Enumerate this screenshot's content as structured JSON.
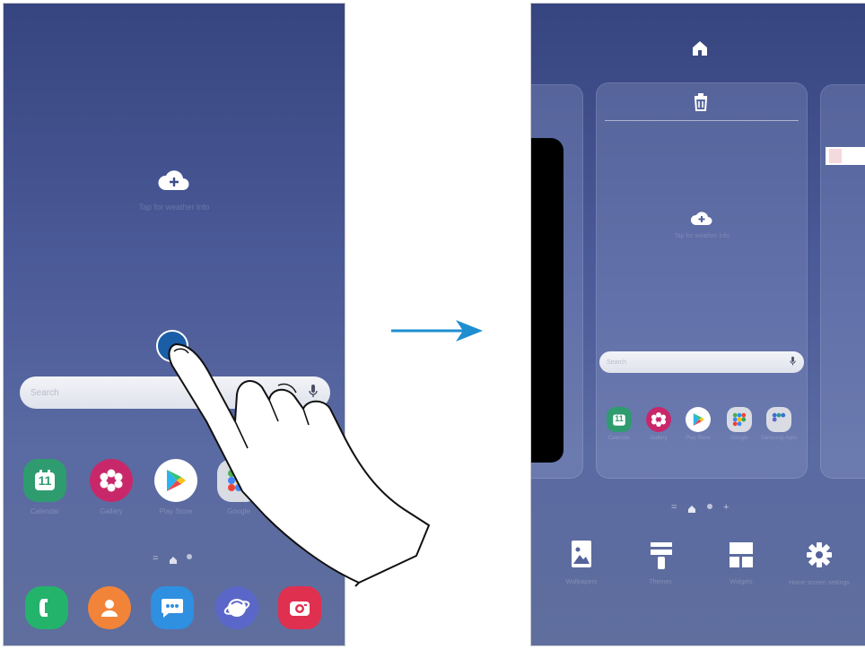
{
  "left_screen": {
    "weather_hint": "Tap for weather info",
    "search_placeholder": "Search",
    "apps": [
      {
        "name": "Calendar",
        "icon": "calendar-icon",
        "color": "#2f9c6f",
        "day": "11"
      },
      {
        "name": "Gallery",
        "icon": "flower-icon",
        "color": "#c8286a"
      },
      {
        "name": "Play Store",
        "icon": "play-store-icon",
        "color": "#ffffff"
      },
      {
        "name": "Google",
        "icon": "folder-icon",
        "color": "#dadce4"
      }
    ],
    "dock": [
      {
        "name": "Phone",
        "icon": "phone-icon",
        "color": "#23b36b"
      },
      {
        "name": "Contacts",
        "icon": "contacts-icon",
        "color": "#f2843a"
      },
      {
        "name": "Messages",
        "icon": "messages-icon",
        "color": "#2f8fe0"
      },
      {
        "name": "Internet",
        "icon": "internet-icon",
        "color": "#5b67c8"
      },
      {
        "name": "Camera",
        "icon": "camera-icon",
        "color": "#e03050"
      }
    ],
    "page_indicator": "="
  },
  "right_screen": {
    "weather_hint": "Tap for weather info",
    "search_placeholder": "Search",
    "apps": [
      {
        "name": "Calendar",
        "day": "11"
      },
      {
        "name": "Gallery"
      },
      {
        "name": "Play Store"
      },
      {
        "name": "Google"
      },
      {
        "name": "Samsung Apps"
      }
    ],
    "page_indicator": "=",
    "add_page": "+",
    "options": [
      {
        "name": "Wallpapers",
        "icon": "wallpaper-icon"
      },
      {
        "name": "Themes",
        "icon": "themes-brush-icon"
      },
      {
        "name": "Widgets",
        "icon": "widgets-icon"
      },
      {
        "name": "Home screen settings",
        "icon": "settings-gear-icon"
      }
    ]
  },
  "colors": {
    "arrow": "#1e8ed0",
    "touch_dot": "#1a5ea8"
  }
}
